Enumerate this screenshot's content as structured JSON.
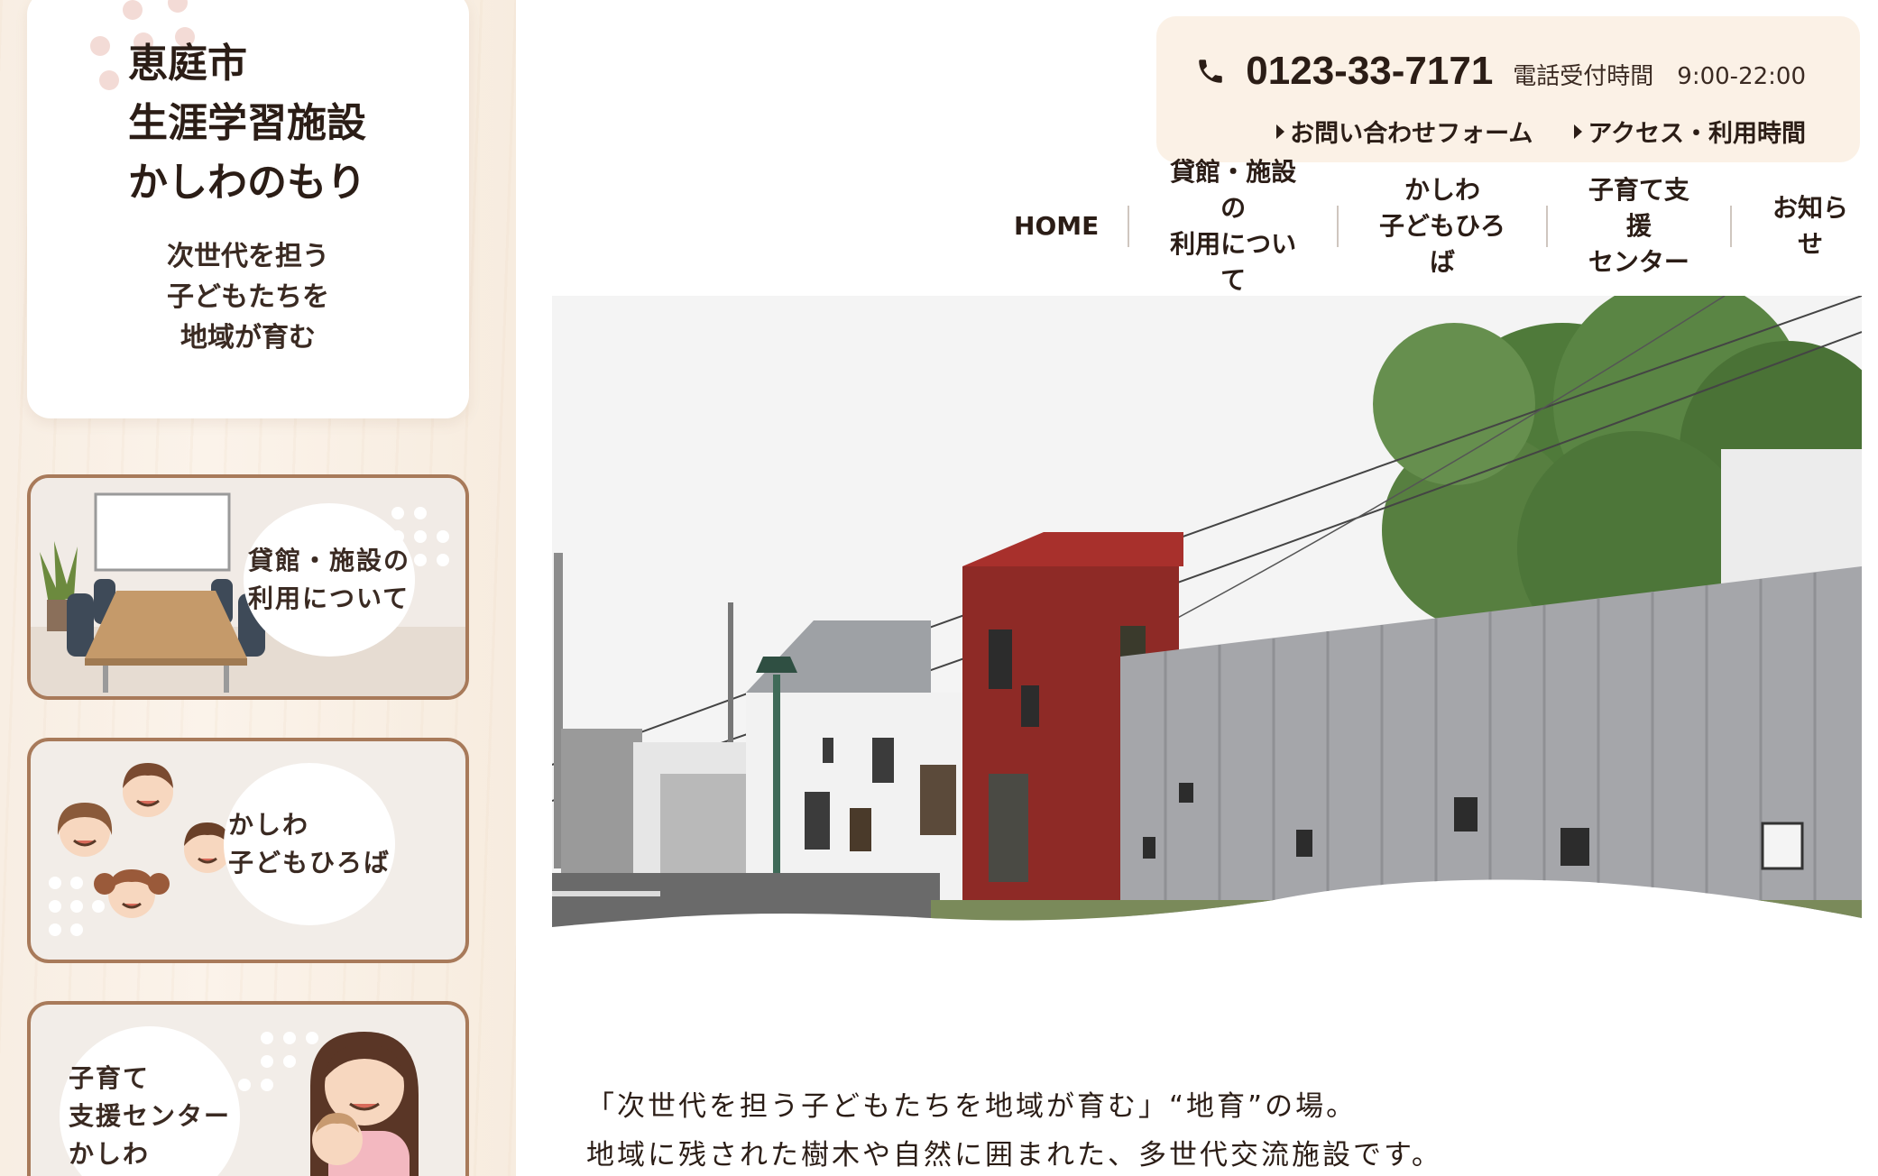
{
  "brand": {
    "title": "恵庭市\n生涯学習施設\nかしわのもり",
    "tagline": "次世代を担う\n子どもたちを\n地域が育む"
  },
  "side_cards": [
    {
      "label": "貸館・施設の\n利用について",
      "icon": "meeting-room-illustration"
    },
    {
      "label": "かしわ\n子どもひろば",
      "icon": "children-faces-illustration"
    },
    {
      "label": "子育て\n支援センター\nかしわ",
      "icon": "mother-baby-illustration"
    }
  ],
  "contact": {
    "phone_icon": "phone-icon",
    "phone": "0123-33-7171",
    "hours": "電話受付時間　9:00-22:00",
    "links": [
      "お問い合わせフォーム",
      "アクセス・利用時間"
    ]
  },
  "nav": {
    "items": [
      "HOME",
      "貸館・施設の\n利用について",
      "かしわ\n子どもひろば",
      "子育て支援\nセンター",
      "お知らせ"
    ]
  },
  "intro": {
    "line1": "「次世代を担う子どもたちを地域が育む」“地育”の場。",
    "line2": "地域に残された樹木や自然に囲まれた、多世代交流施設です。"
  },
  "colors": {
    "sidebar_bg": "#f8eee3",
    "card_border": "#a87a5a",
    "contact_bg": "#fbf1e6",
    "text": "#2b1d16"
  }
}
